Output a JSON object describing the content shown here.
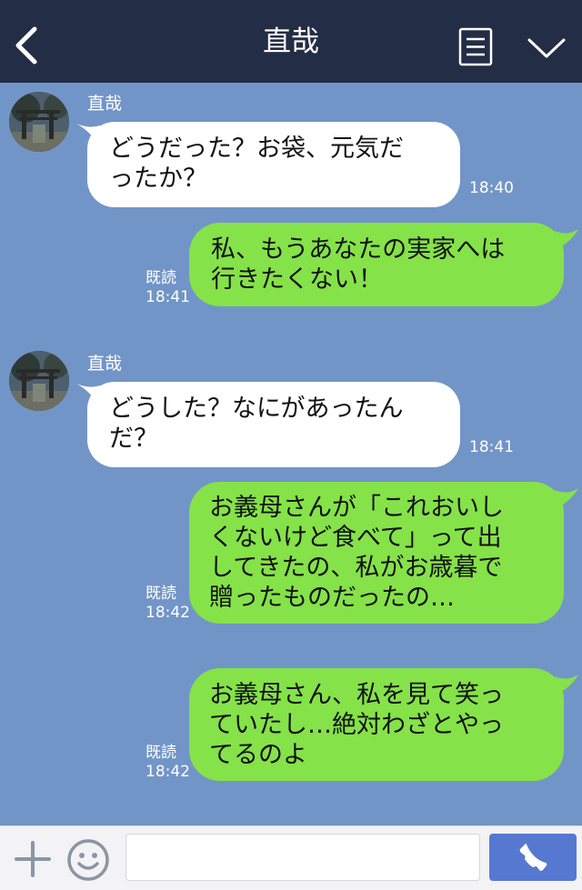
{
  "header": {
    "back_icon": "chevron-left-icon",
    "title": "直哉",
    "menu_icon": "menu-icon",
    "dropdown_icon": "chevron-down-icon"
  },
  "messages": [
    {
      "direction": "incoming",
      "sender": "直哉",
      "text": "どうだった？お袋、元気だ\nったか？",
      "time": "18:40"
    },
    {
      "direction": "outgoing",
      "text": "私、もうあなたの実家へは\n行きたくない！",
      "read": "既読",
      "time": "18:41"
    },
    {
      "direction": "incoming",
      "sender": "直哉",
      "text": "どうした？なにがあったん\nだ？",
      "time": "18:41"
    },
    {
      "direction": "outgoing",
      "text": "お義母さんが「これおいし\nくないけど食べて」って出\nしてきたの、私がお歳暮で\n贈ったものだったの…",
      "read": "既読",
      "time": "18:42"
    },
    {
      "direction": "outgoing",
      "text": "お義母さん、私を見て笑っ\nていたし…絶対わざとやっ\nてるのよ",
      "read": "既読",
      "time": "18:42"
    }
  ],
  "input_bar": {
    "plus_icon": "plus-icon",
    "emoji_icon": "emoji-icon",
    "message_value": "",
    "call_icon": "phone-icon"
  },
  "colors": {
    "header_bg": "#232d45",
    "chat_bg": "#7295c7",
    "incoming_bubble": "#ffffff",
    "outgoing_bubble": "#85e249",
    "call_button": "#5778d1"
  }
}
